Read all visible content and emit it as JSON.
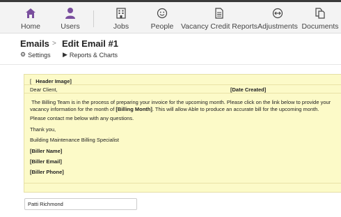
{
  "colors": {
    "accent": "#7a4f9e",
    "nav_background": "#f3f3f3",
    "editor_background": "#fcfac8"
  },
  "nav": {
    "items": [
      {
        "label": "Home",
        "icon": "home-icon"
      },
      {
        "label": "Users",
        "icon": "user-icon"
      },
      {
        "label": "Jobs",
        "icon": "building-icon"
      },
      {
        "label": "People",
        "icon": "smiley-icon"
      },
      {
        "label": "Vacancy Credit Reports",
        "icon": "document-icon"
      },
      {
        "label": "Adjustments",
        "icon": "arrows-icon"
      },
      {
        "label": "Documents",
        "icon": "documents-icon"
      }
    ]
  },
  "breadcrumb": {
    "root": "Emails",
    "separator": ">",
    "current": "Edit Email #1"
  },
  "subnav": {
    "settings": "Settings",
    "reports": "Reports & Charts"
  },
  "email": {
    "header_bracket": "[",
    "header_image": "Header Image]",
    "greeting": "Dear Client,",
    "date_created": "[Date Created]",
    "para_part1": "The Billing Team is in the process of preparing your invoice for the upcoming month. Please click on the link below to provide your vacancy information for the month of ",
    "billing_month": "[Billing Month]",
    "para_part2": ". This will allow Able to produce an accurate bill for the upcoming month.",
    "contact": "Please contact me below with any questions.",
    "thanks": "Thank you,",
    "signature_title": "Building Maintenance Billing Specialist",
    "biller_name": "[Biller Name]",
    "biller_email": "[Biller Email]",
    "biller_phone": "[Biller Phone]"
  },
  "form": {
    "sender_name_value": "Patti Richmond"
  }
}
